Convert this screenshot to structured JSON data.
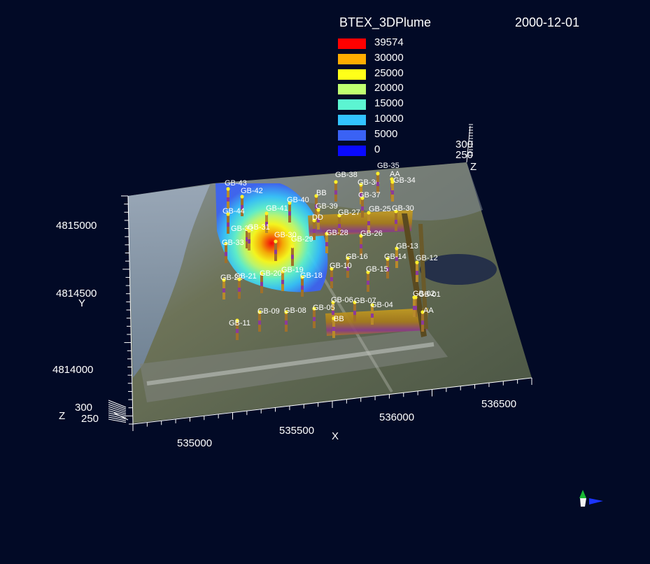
{
  "title": "BTEX_3DPlume",
  "date": "2000-12-01",
  "legend": [
    {
      "label": "39574",
      "color": "#ff0000"
    },
    {
      "label": "30000",
      "color": "#ffad00"
    },
    {
      "label": "25000",
      "color": "#ffff19"
    },
    {
      "label": "20000",
      "color": "#c0ff70"
    },
    {
      "label": "15000",
      "color": "#5cf5d2"
    },
    {
      "label": "10000",
      "color": "#32c3ff"
    },
    {
      "label": "5000",
      "color": "#3a62f5"
    },
    {
      "label": "0",
      "color": "#0a0aff"
    }
  ],
  "axes": {
    "x": {
      "label": "X",
      "ticks": [
        "535000",
        "535500",
        "536000",
        "536500"
      ]
    },
    "y": {
      "label": "Y",
      "ticks": [
        "4815000",
        "4814500",
        "4814000"
      ]
    },
    "z_front": {
      "label": "Z",
      "ticks": [
        "300",
        "250"
      ]
    },
    "z_back": {
      "label": "Z",
      "ticks": [
        "300",
        "250"
      ]
    }
  },
  "wells": [
    "GB-43",
    "GB-42",
    "GB-44",
    "GB-41",
    "GB-40",
    "BB",
    "GB-39",
    "DD",
    "GB-38",
    "GB-36",
    "GB-35",
    "AA",
    "GB-34",
    "GB-37",
    "GB-27",
    "GB-25",
    "GB-30",
    "GB-32",
    "GB-31",
    "GB-30",
    "GB-29",
    "GB-28",
    "GB-26",
    "GB-33",
    "GB-13",
    "GB-14",
    "GB-16",
    "GB-12",
    "GB-10",
    "GB-15",
    "GB-22",
    "GB-21",
    "GB-20",
    "GB-19",
    "GB-18",
    "GB-02",
    "GB-01",
    "GB-09",
    "GB-08",
    "GB-06",
    "GB-05",
    "GB-07",
    "GB-04",
    "AA",
    "GB-11",
    "BB"
  ],
  "orientation_triad": {
    "x_color": "#1b34ff",
    "y_color": "#19b832",
    "z_color": "#f2f2f2"
  }
}
